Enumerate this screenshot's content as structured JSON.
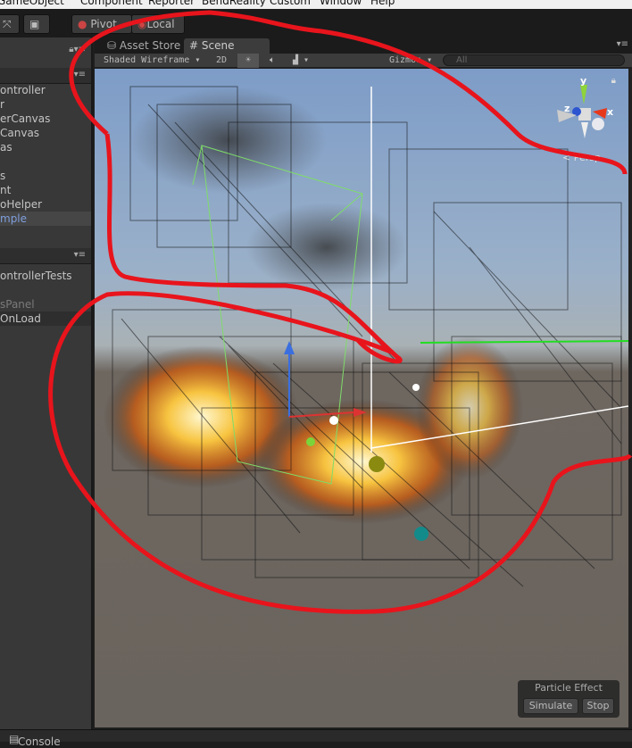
{
  "menubar": {
    "items": [
      "GameObject",
      "Component",
      "Reporter",
      "BendReality",
      "Custom",
      "Window",
      "Help"
    ]
  },
  "toolbar": {
    "pivot": "Pivot",
    "local": "Local"
  },
  "hierarchy": {
    "items": [
      {
        "label": "ontroller"
      },
      {
        "label": "r"
      },
      {
        "label": "erCanvas"
      },
      {
        "label": "Canvas"
      },
      {
        "label": "as"
      },
      {
        "label": ""
      },
      {
        "label": "s"
      },
      {
        "label": "nt"
      },
      {
        "label": "oHelper"
      },
      {
        "label": "mple",
        "selected": true
      }
    ]
  },
  "project": {
    "items": [
      {
        "label": "ontrollerTests"
      },
      {
        "label": ""
      },
      {
        "label": "sPanel",
        "dim": true
      },
      {
        "label": "OnLoad"
      }
    ]
  },
  "tabs": {
    "asset_store": "Asset Store",
    "scene": "Scene"
  },
  "scenebar": {
    "shading": "Shaded Wireframe",
    "mode_2d": "2D",
    "gizmos": "Gizmos",
    "search_placeholder": "All"
  },
  "gizmo": {
    "y": "y",
    "x": "x",
    "z": "z",
    "projection": "Persp"
  },
  "particle_effect": {
    "title": "Particle Effect",
    "simulate": "Simulate",
    "stop": "Stop"
  },
  "console": {
    "label": "Console"
  },
  "colors": {
    "annotation": "#e8141c",
    "selected_text": "#7f9fdc",
    "sky": "#7d9cc7",
    "ground": "#6a645e"
  }
}
